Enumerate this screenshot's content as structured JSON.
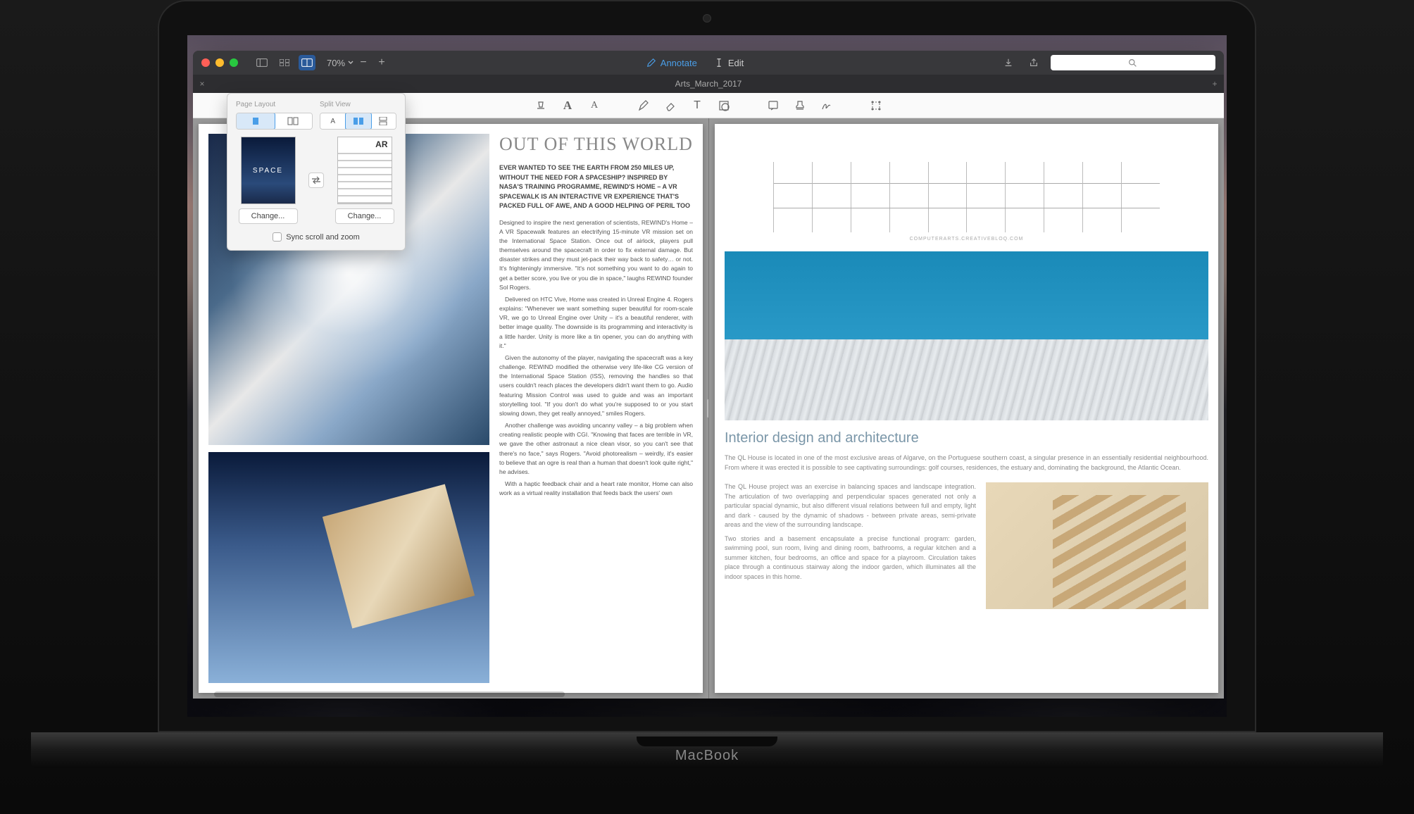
{
  "device_label": "MacBook",
  "titlebar": {
    "zoom": "70%",
    "annotate": "Annotate",
    "edit": "Edit",
    "search_placeholder": ""
  },
  "tab": {
    "title": "Arts_March_2017"
  },
  "popover": {
    "page_layout_label": "Page Layout",
    "split_view_label": "Split View",
    "thumb_left_label": "SPACE",
    "thumb_right_badge": "AR",
    "change_left": "Change...",
    "change_right": "Change...",
    "sync_label": "Sync scroll and zoom"
  },
  "left_article": {
    "title": "OUT OF THIS WORLD",
    "lead": "EVER WANTED TO SEE THE EARTH FROM 250 MILES UP, WITHOUT THE NEED FOR A SPACESHIP? INSPIRED BY NASA'S TRAINING PROGRAMME, REWIND'S HOME – A VR SPACEWALK IS AN INTERACTIVE VR EXPERIENCE THAT'S PACKED FULL OF AWE, AND A GOOD HELPING OF PERIL TOO",
    "p1": "Designed to inspire the next generation of scientists, REWIND's Home – A VR Spacewalk features an electrifying 15-minute VR mission set on the International Space Station. Once out of airlock, players pull themselves around the spacecraft in order to fix external damage. But disaster strikes and they must jet-pack their way back to safety… or not. It's frighteningly immersive. \"It's not something you want to do again to get a better score, you live or you die in space,\" laughs REWIND founder Sol Rogers.",
    "p2": "Delivered on HTC Vive, Home was created in Unreal Engine 4. Rogers explains: \"Whenever we want something super beautiful for room-scale VR, we go to Unreal Engine over Unity – it's a beautiful renderer, with better image quality. The downside is its programming and interactivity is a little harder. Unity is more like a tin opener, you can do anything with it.\"",
    "p3": "Given the autonomy of the player, navigating the spacecraft was a key challenge. REWIND modified the otherwise very life-like CG version of the International Space Station (ISS), removing the handles so that users couldn't reach places the developers didn't want them to go. Audio featuring Mission Control was used to guide and was an important storytelling tool. \"If you don't do what you're supposed to or you start slowing down, they get really annoyed,\" smiles Rogers.",
    "p4": "Another challenge was avoiding uncanny valley – a big problem when creating realistic people with CGI. \"Knowing that faces are terrible in VR, we gave the other astronaut a nice clean visor, so you can't see that there's no face,\" says Rogers. \"Avoid photorealism – weirdly, it's easier to believe that an ogre is real than a human that doesn't look quite right,\" he advises.",
    "p5": "With a haptic feedback chair and a heart rate monitor, Home can also work as a virtual reality installation that feeds back the users' own"
  },
  "right_article": {
    "url": "COMPUTERARTS.CREATIVEBLOQ.COM",
    "title": "Interior design and architecture",
    "intro": "The QL House is located in one of the most exclusive areas of Algarve, on the Portuguese southern coast, a singular presence in an essentially residential neighbourhood. From where it was erected it is possible to see captivating surroundings: golf courses, residences, the estuary and, dominating the background, the Atlantic Ocean.",
    "p1": "The QL House project was an exercise in balancing spaces and landscape integration. The articulation of two overlapping and perpendicular spaces generated not only a particular spacial dynamic, but also different visual relations between full and empty, light and dark - caused by the dynamic of shadows - between private areas, semi-private areas and the view of the surrounding landscape.",
    "p2": "Two stories and a basement encapsulate a precise functional program: garden, swimming pool, sun room, living and dining room, bathrooms, a regular kitchen and a summer kitchen, four bedrooms, an office and space for a playroom. Circulation takes place through a continuous stairway along the indoor garden, which illuminates all the indoor spaces in this home."
  }
}
